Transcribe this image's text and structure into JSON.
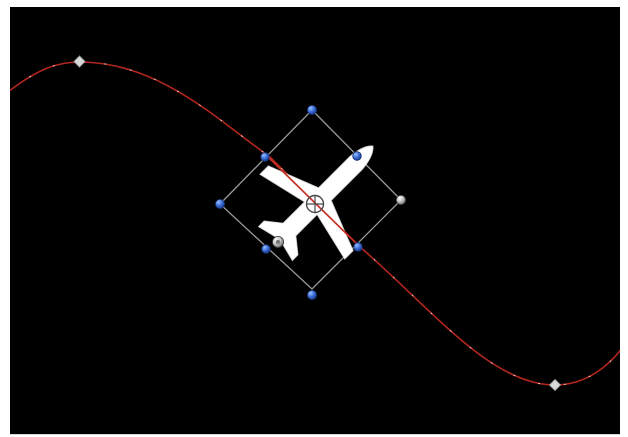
{
  "viewer": {
    "background_color": "#000000",
    "frame_color": "#ffffff"
  },
  "motion_path": {
    "stroke_color": "#b3261e",
    "dash_color": "#e8e8e8",
    "keyframe_color": "#d9d9d9"
  },
  "object": {
    "icon": "airplane-icon",
    "fill_color": "#ffffff",
    "rotation_degrees": 45
  },
  "transform_box": {
    "outline_color": "#9a9a9a",
    "handle_color": "#3b6fd8",
    "anchor_icon": "crosshair-icon",
    "rotation_handle_icon": "rotation-handle-icon"
  }
}
